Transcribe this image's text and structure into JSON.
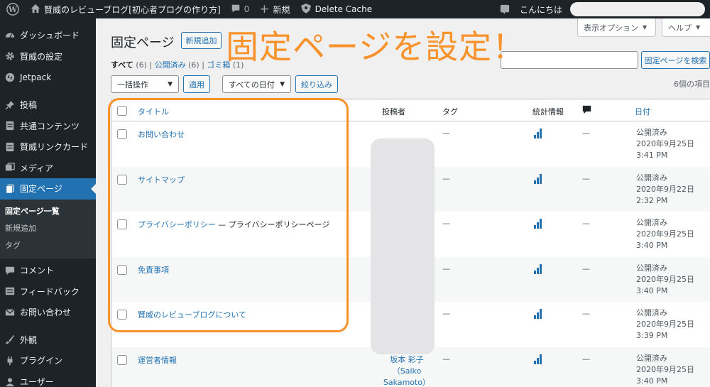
{
  "adminbar": {
    "site_name": "賢威のレビューブログ[初心者ブログの作り方]",
    "comments_count": "0",
    "new_label": "新規",
    "cache_label": "Delete Cache",
    "greeting": "こんにちは"
  },
  "sidebar": {
    "items": [
      {
        "label": "ダッシュボード",
        "icon": "dashboard-icon"
      },
      {
        "label": "賢威の設定",
        "icon": "gear-icon"
      },
      {
        "label": "Jetpack",
        "icon": "jetpack-icon"
      },
      {
        "label": "投稿",
        "icon": "pin-icon"
      },
      {
        "label": "共通コンテンツ",
        "icon": "document-icon"
      },
      {
        "label": "賢威リンクカード",
        "icon": "document-icon"
      },
      {
        "label": "メディア",
        "icon": "media-icon"
      },
      {
        "label": "固定ページ",
        "icon": "pages-icon"
      },
      {
        "label": "コメント",
        "icon": "comment-icon"
      },
      {
        "label": "フィードバック",
        "icon": "feedback-icon"
      },
      {
        "label": "お問い合わせ",
        "icon": "mail-icon"
      },
      {
        "label": "外観",
        "icon": "brush-icon"
      },
      {
        "label": "プラグイン",
        "icon": "plugin-icon"
      },
      {
        "label": "ユーザー",
        "icon": "user-icon"
      }
    ],
    "submenu": [
      "固定ページ一覧",
      "新規追加",
      "タグ"
    ]
  },
  "header": {
    "screen_options": "表示オプション",
    "help": "ヘルプ",
    "title": "固定ページ",
    "add_new": "新規追加",
    "search_button": "固定ページを検索"
  },
  "views": {
    "all": "すべて",
    "all_count": "(6)",
    "published": "公開済み",
    "published_count": "(6)",
    "trash": "ゴミ箱",
    "trash_count": "(1)"
  },
  "filters": {
    "bulk_action": "一括操作",
    "apply": "適用",
    "all_dates": "すべての日付",
    "filter": "絞り込み",
    "items_count": "6個の項目"
  },
  "table": {
    "columns": {
      "title": "タイトル",
      "author": "投稿者",
      "tags": "タグ",
      "stats": "統計情報",
      "date": "日付"
    },
    "rows": [
      {
        "title": "お問い合わせ",
        "state": "",
        "author": "",
        "tags": "—",
        "comments": "—",
        "status": "公開済み",
        "date": "2020年9月25日",
        "time": "3:41 PM"
      },
      {
        "title": "サイトマップ",
        "state": "",
        "author": "",
        "tags": "—",
        "comments": "—",
        "status": "公開済み",
        "date": "2020年9月22日",
        "time": "2:32 PM"
      },
      {
        "title": "プライバシーポリシー",
        "state": " — プライバシーポリシーページ",
        "author": "",
        "tags": "—",
        "comments": "—",
        "status": "公開済み",
        "date": "2020年9月25日",
        "time": "3:40 PM"
      },
      {
        "title": "免責事項",
        "state": "",
        "author": "",
        "tags": "—",
        "comments": "—",
        "status": "公開済み",
        "date": "2020年9月25日",
        "time": "3:40 PM"
      },
      {
        "title": "賢威のレビューブログについて",
        "state": "",
        "author": "",
        "tags": "—",
        "comments": "—",
        "status": "公開済み",
        "date": "2020年9月25日",
        "time": "3:39 PM"
      },
      {
        "title": "運営者情報",
        "state": "",
        "author": "坂本 彩子（Saiko Sakamoto）",
        "tags": "—",
        "comments": "—",
        "status": "公開済み",
        "date": "2020年9月25日",
        "time": "3:40 PM"
      }
    ]
  },
  "overlay": {
    "text": "固定ページを設定！",
    "color": "#f8922b"
  }
}
